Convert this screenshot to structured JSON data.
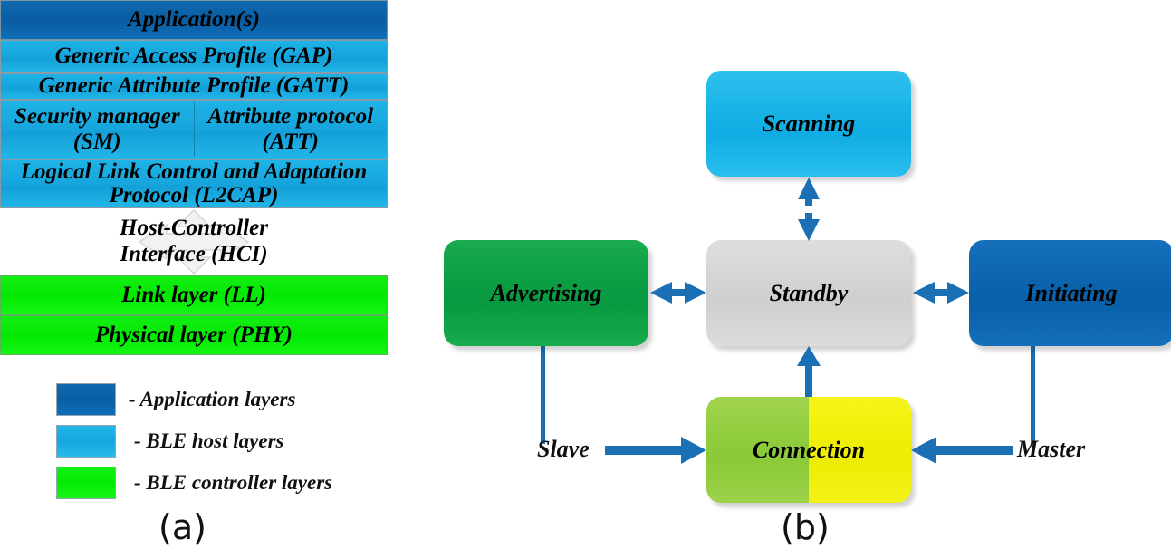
{
  "figure": {
    "panel_a_caption": "(a)",
    "panel_b_caption": "(b)"
  },
  "colors": {
    "application_layer": "#0B62A8",
    "ble_host_layer": "#1BAEE2",
    "ble_controller_layer": "#00EE00",
    "arrow_blue": "#1A6FB5",
    "standby_gray": "#D2D2D2",
    "advertising_green": "#0A9C42",
    "initiating_blue": "#0A62AB",
    "scanning_cyan": "#16B1E6",
    "connection_green": "#8ECB3C",
    "connection_yellow": "#EEEE06"
  },
  "stack": {
    "rows": [
      {
        "label": "Application(s)",
        "group": "application"
      },
      {
        "label": "Generic Access Profile (GAP)",
        "group": "host"
      },
      {
        "label": "Generic Attribute Profile (GATT)",
        "group": "host"
      },
      {
        "label_left": "Security manager (SM)",
        "label_right": "Attribute protocol (ATT)",
        "group": "host",
        "split": true
      },
      {
        "label": "Logical Link Control and Adaptation Protocol (L2CAP)",
        "group": "host"
      }
    ],
    "hci": {
      "line1": "Host-Controller",
      "line2": "Interface (HCI)",
      "watermark_icon": "four-way-arrow-icon"
    },
    "controller_rows": [
      {
        "label": "Link layer (LL)",
        "group": "controller"
      },
      {
        "label": "Physical layer (PHY)",
        "group": "controller"
      }
    ]
  },
  "legend": {
    "items": [
      {
        "label": "- Application layers",
        "color": "#0B62A8"
      },
      {
        "label": "- BLE host layers",
        "color": "#1BAEE2"
      },
      {
        "label": "- BLE controller layers",
        "color": "#00EE00"
      }
    ]
  },
  "state_diagram": {
    "states": [
      {
        "id": "scanning",
        "label": "Scanning"
      },
      {
        "id": "advertising",
        "label": "Advertising"
      },
      {
        "id": "standby",
        "label": "Standby"
      },
      {
        "id": "initiating",
        "label": "Initiating"
      },
      {
        "id": "connection",
        "label": "Connection"
      }
    ],
    "edge_labels": [
      {
        "id": "slave",
        "label": "Slave"
      },
      {
        "id": "master",
        "label": "Master"
      }
    ],
    "transitions": [
      {
        "from": "standby",
        "to": "scanning",
        "type": "bidirectional"
      },
      {
        "from": "advertising",
        "to": "standby",
        "type": "bidirectional"
      },
      {
        "from": "standby",
        "to": "initiating",
        "type": "bidirectional"
      },
      {
        "from": "connection",
        "to": "standby",
        "type": "unidirectional"
      },
      {
        "from": "slave",
        "to": "connection",
        "type": "unidirectional"
      },
      {
        "from": "master",
        "to": "connection",
        "type": "unidirectional"
      }
    ]
  }
}
